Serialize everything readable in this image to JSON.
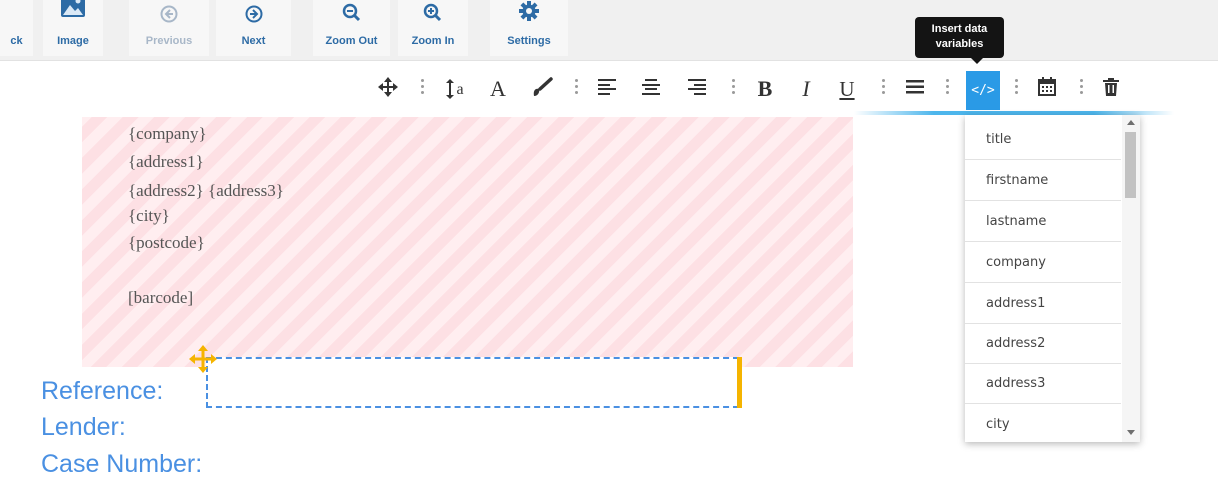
{
  "toolbar": {
    "back_label": "ck",
    "image_label": "Image",
    "previous_label": "Previous",
    "next_label": "Next",
    "zoom_out_label": "Zoom Out",
    "zoom_in_label": "Zoom In",
    "settings_label": "Settings"
  },
  "tooltip": {
    "line1": "Insert data",
    "line2": "variables"
  },
  "format_toolbar": {
    "font_family_glyph": "a",
    "font_style_glyph": "A",
    "bold": "B",
    "italic": "I",
    "underline": "U",
    "code_glyph": "</>"
  },
  "address_block": {
    "line_company": "{company}",
    "line_address1": "{address1}",
    "line_address2_3": "{address2} {address3}",
    "line_city": "{city}",
    "line_postcode": "{postcode}",
    "line_barcode": "[barcode]"
  },
  "fields": {
    "reference_label": "Reference:",
    "lender_label": "Lender:",
    "case_number_label": "Case Number:"
  },
  "variables_menu": {
    "items": [
      "title",
      "firstname",
      "lastname",
      "company",
      "address1",
      "address2",
      "address3",
      "city"
    ]
  },
  "colors": {
    "accent": "#2a9ae6",
    "link_blue": "#4a90e2",
    "selection_handle": "#f5b400",
    "stripe_pink": "#fde0e4"
  }
}
